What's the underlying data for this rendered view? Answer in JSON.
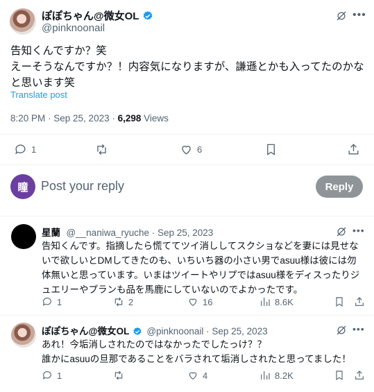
{
  "main_tweet": {
    "author_name": "ぽぽちゃん@微女OL",
    "author_handle": "@pinknoonail",
    "text": "告知くんですか？笑\nえーそうなんですか？！内容気になりますが、謙遜とかも入ってたのかな\nと思います笑",
    "translate_label": "Translate post",
    "time": "8:20 PM · Sep 25, 2023 · ",
    "views_count": "6,298",
    "views_label": " Views",
    "reply_count": "1",
    "like_count": "6"
  },
  "compose": {
    "avatar_letter": "瞳",
    "placeholder": "Post your reply",
    "reply_button": "Reply"
  },
  "replies": [
    {
      "author_name": "星蘭",
      "author_handle": "@__naniwa_ryuche · Sep 25, 2023",
      "text": "告知くんです。指摘したら慌ててツイ消ししてスクショなどを妻には見せな\nいで欲しいとDMしてきたのも、いちいち器の小さい男でasuu様は彼には勿\n体無いと思っています。いまはツイートやリプではasuu様をディスったりジ\nュエリーやプランも品を馬鹿にしていないのでよかったです。",
      "reply_count": "1",
      "repost_count": "2",
      "like_count": "16",
      "views": "8.6K"
    },
    {
      "author_name": "ぽぽちゃん@微女OL",
      "author_handle": "@pinknoonail · Sep 25, 2023",
      "text": "あれ！今垢消しされたのではなかったでしたっけ？？\n誰かにasuuの旦那であることをバラされて垢消しされたと思ってました！",
      "reply_count": "1",
      "repost_count": "",
      "like_count": "4",
      "views": "8.2K"
    }
  ],
  "colors": {
    "accent": "#1d9bf0",
    "muted": "#536471",
    "reply_button_bg": "#8e9497"
  }
}
